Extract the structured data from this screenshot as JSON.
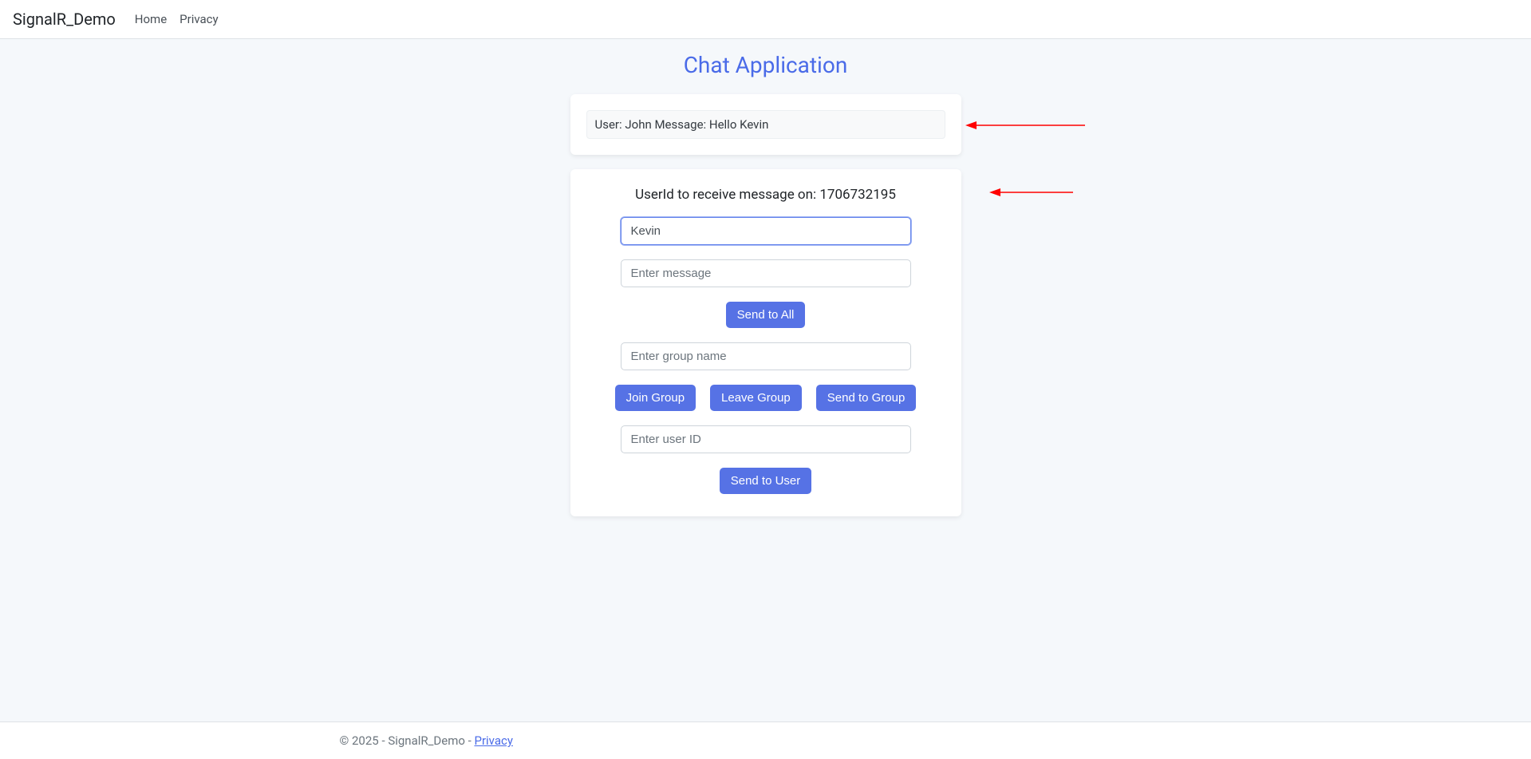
{
  "navbar": {
    "brand": "SignalR_Demo",
    "links": [
      {
        "label": "Home"
      },
      {
        "label": "Privacy"
      }
    ]
  },
  "page_title": "Chat Application",
  "messages": [
    {
      "text": "User: John Message: Hello Kevin"
    }
  ],
  "form": {
    "user_id_label_prefix": "UserId to receive message on: ",
    "user_id": "1706732195",
    "username_value": "Kevin",
    "message_placeholder": "Enter message",
    "send_all_label": "Send to All",
    "group_placeholder": "Enter group name",
    "join_group_label": "Join Group",
    "leave_group_label": "Leave Group",
    "send_group_label": "Send to Group",
    "userid_placeholder": "Enter user ID",
    "send_user_label": "Send to User"
  },
  "footer": {
    "copyright": "© 2025 - SignalR_Demo - ",
    "privacy_label": "Privacy"
  }
}
